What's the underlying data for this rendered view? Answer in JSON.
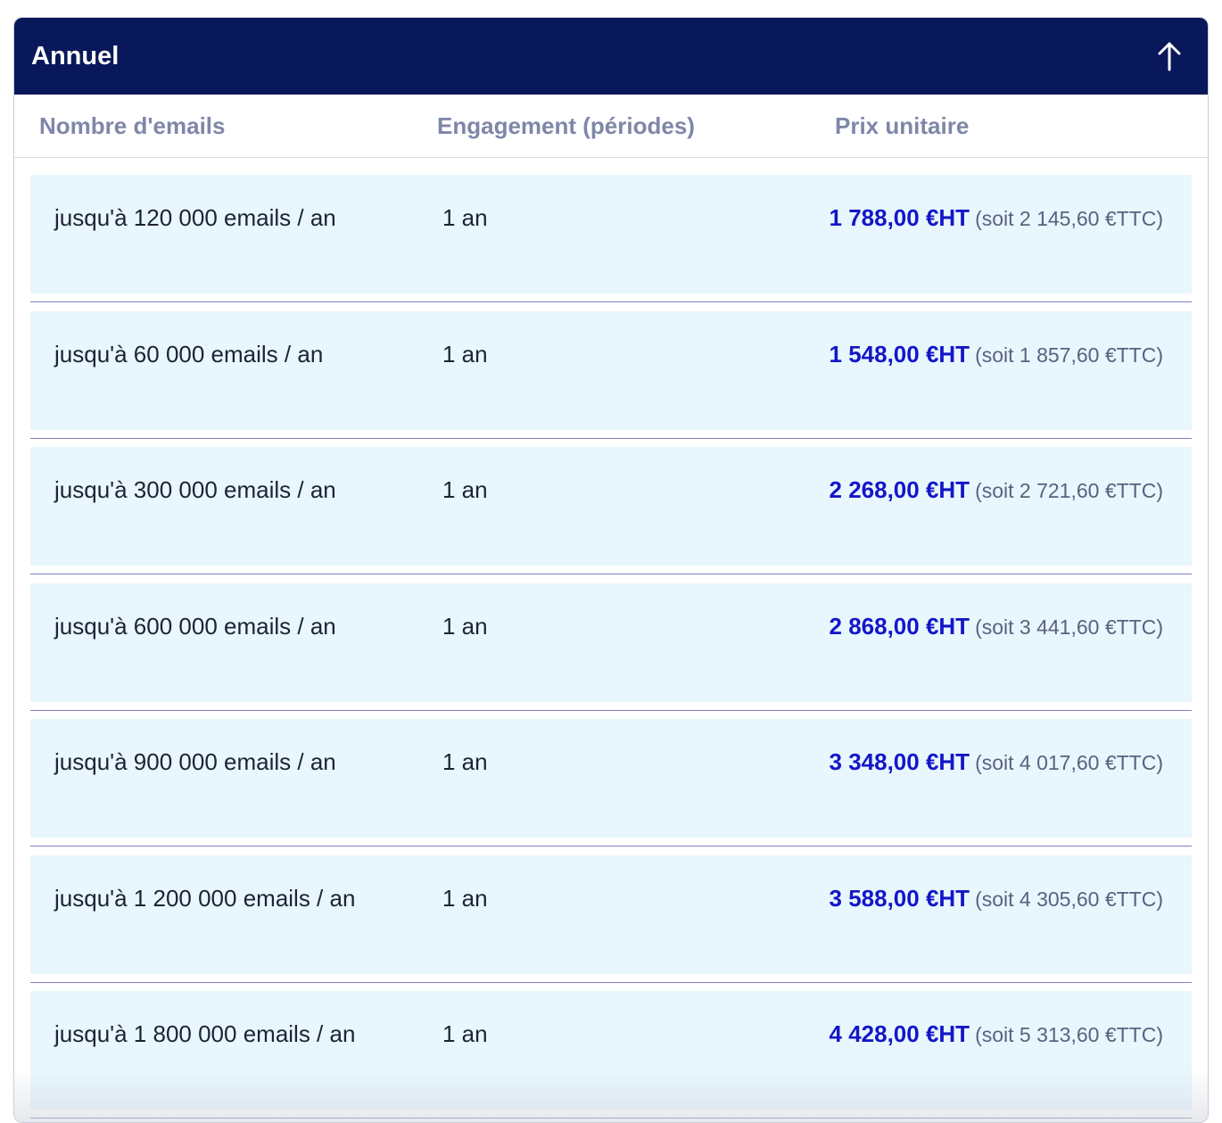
{
  "panel": {
    "title": "Annuel",
    "toggle_icon": "arrow-up-icon"
  },
  "columns": {
    "emails": "Nombre d'emails",
    "engagement": "Engagement (périodes)",
    "price": "Prix unitaire"
  },
  "rows": [
    {
      "emails": "jusqu'à 120 000 emails / an",
      "engagement": "1 an",
      "price_ht": "1 788,00 €HT",
      "price_ttc": "(soit 2 145,60 €TTC)"
    },
    {
      "emails": "jusqu'à 60 000 emails / an",
      "engagement": "1 an",
      "price_ht": "1 548,00 €HT",
      "price_ttc": "(soit 1 857,60 €TTC)"
    },
    {
      "emails": "jusqu'à 300 000 emails / an",
      "engagement": "1 an",
      "price_ht": "2 268,00 €HT",
      "price_ttc": "(soit 2 721,60 €TTC)"
    },
    {
      "emails": "jusqu'à 600 000 emails / an",
      "engagement": "1 an",
      "price_ht": "2 868,00 €HT",
      "price_ttc": "(soit 3 441,60 €TTC)"
    },
    {
      "emails": "jusqu'à 900 000 emails / an",
      "engagement": "1 an",
      "price_ht": "3 348,00 €HT",
      "price_ttc": "(soit 4 017,60 €TTC)"
    },
    {
      "emails": "jusqu'à 1 200 000 emails / an",
      "engagement": "1 an",
      "price_ht": "3 588,00 €HT",
      "price_ttc": "(soit 4 305,60 €TTC)"
    },
    {
      "emails": "jusqu'à 1 800 000 emails / an",
      "engagement": "1 an",
      "price_ht": "4 428,00 €HT",
      "price_ttc": "(soit 5 313,60 €TTC)"
    }
  ],
  "colors": {
    "header_bg": "#08185a",
    "row_bg": "#e8f6fd",
    "price_accent": "#1316c8"
  }
}
